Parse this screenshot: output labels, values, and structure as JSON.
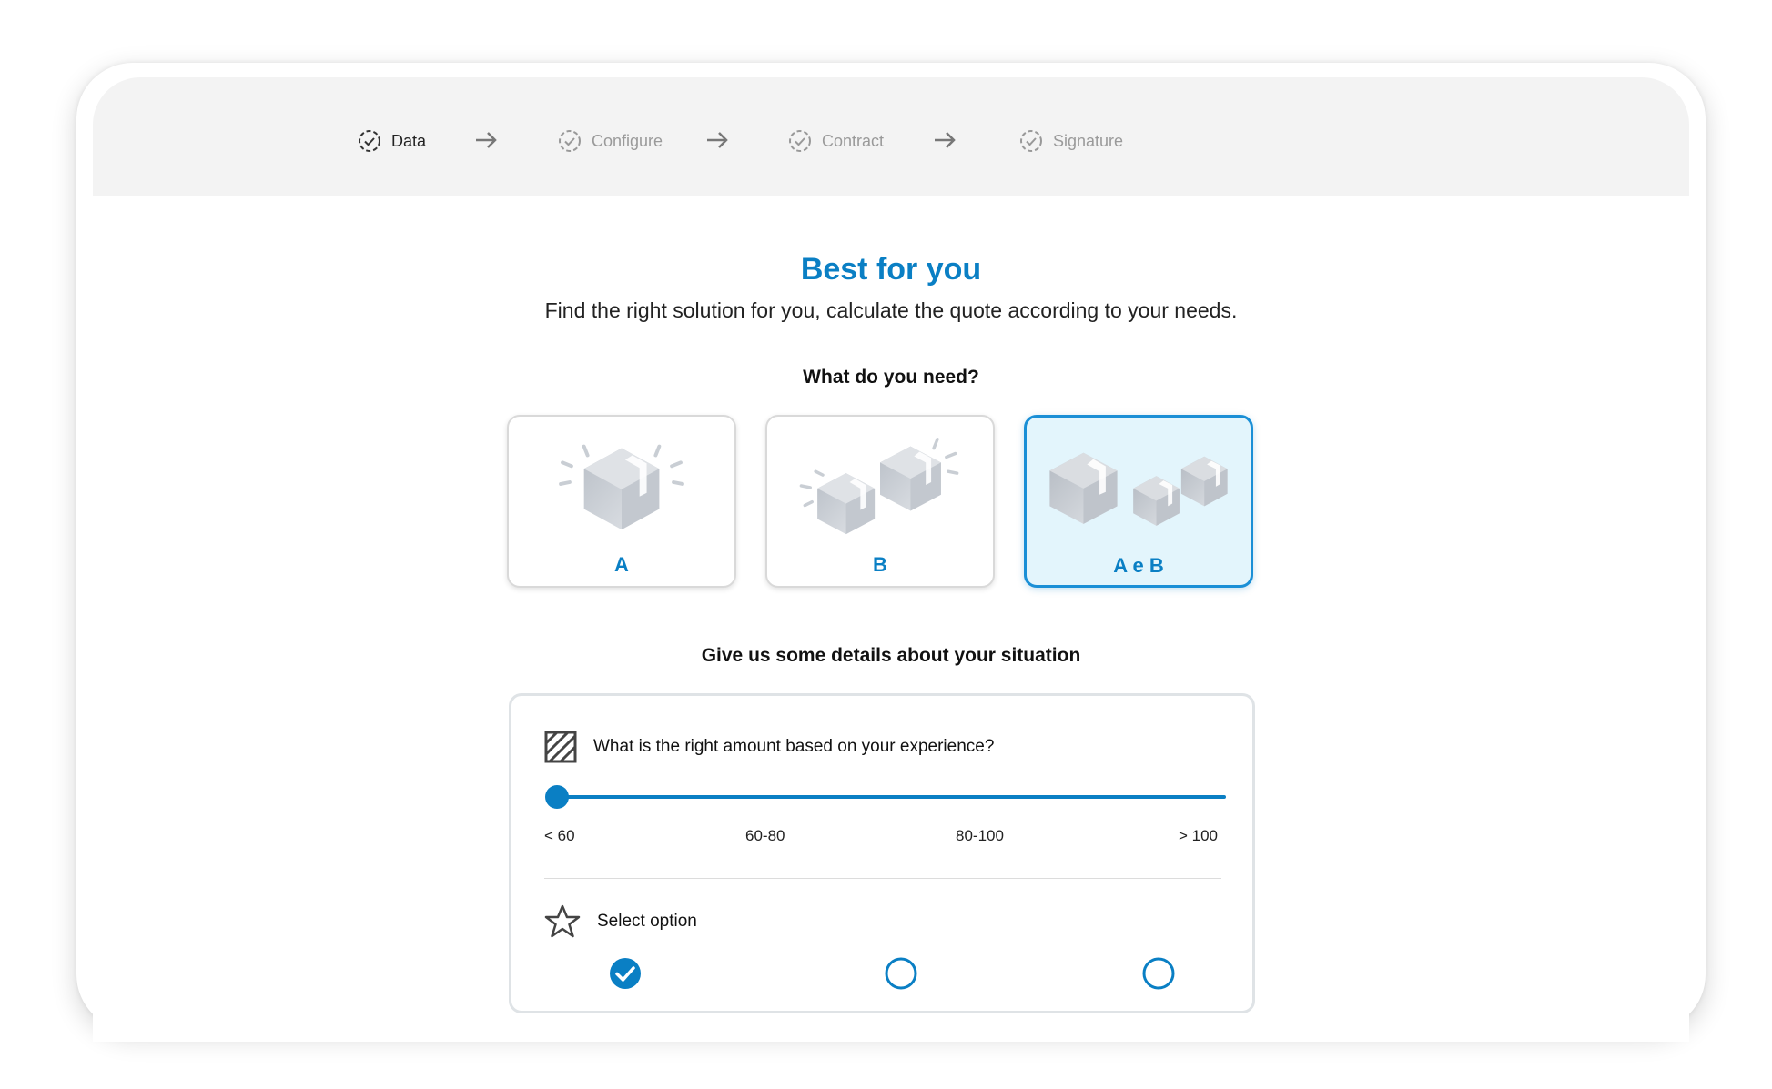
{
  "stepper": {
    "steps": [
      {
        "label": "Data",
        "active": true
      },
      {
        "label": "Configure",
        "active": false
      },
      {
        "label": "Contract",
        "active": false
      },
      {
        "label": "Signature",
        "active": false
      }
    ]
  },
  "main": {
    "title": "Best for you",
    "subtitle": "Find the right solution for you, calculate the quote according to your needs.",
    "need_question": "What do you need?",
    "options": [
      {
        "label": "A",
        "selected": false
      },
      {
        "label": "B",
        "selected": false
      },
      {
        "label": "A e B",
        "selected": true
      }
    ],
    "details_question": "Give us some details about your situation"
  },
  "details": {
    "amount": {
      "question": "What is the right amount based on your experience?",
      "ticks": [
        "< 60",
        "60-80",
        "80-100",
        "> 100"
      ],
      "selected_index": 0
    },
    "select": {
      "label": "Select option",
      "options_checked": [
        true,
        false,
        false
      ]
    }
  },
  "colors": {
    "accent": "#0a7fc4",
    "selected_card_bg": "#e3f5fc",
    "inactive_text": "#9a9a9a"
  }
}
